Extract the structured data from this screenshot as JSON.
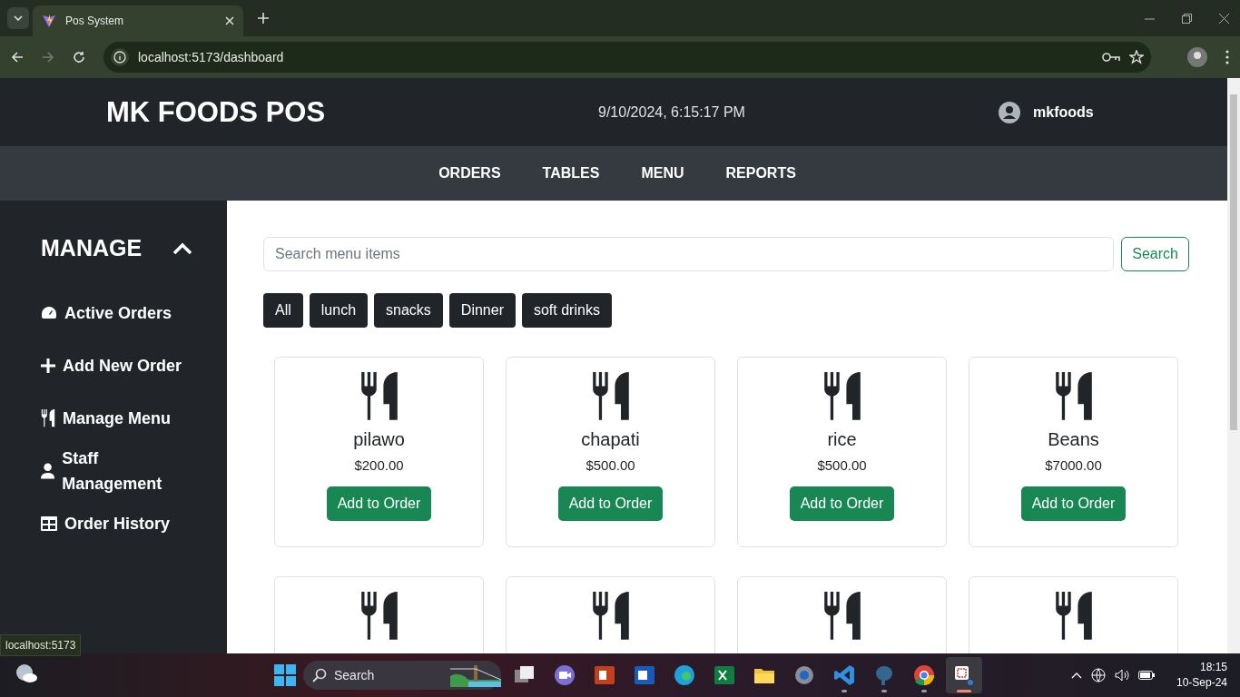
{
  "browser": {
    "tab_title": "Pos System",
    "url": "localhost:5173/dashboard",
    "status_url": "localhost:5173"
  },
  "header": {
    "brand": "MK FOODS POS",
    "datetime": "9/10/2024, 6:15:17 PM",
    "username": "mkfoods"
  },
  "nav": [
    {
      "label": "ORDERS"
    },
    {
      "label": "TABLES"
    },
    {
      "label": "MENU"
    },
    {
      "label": "REPORTS"
    }
  ],
  "sidebar": {
    "title": "MANAGE",
    "expanded": true,
    "items": [
      {
        "label": "Active Orders",
        "kind": "gauge"
      },
      {
        "label": "Add New Order",
        "kind": "plus"
      },
      {
        "label": "Manage Menu",
        "kind": "utensils"
      },
      {
        "label": "Staff Management",
        "kind": "user"
      },
      {
        "label": "Order History",
        "kind": "table"
      }
    ]
  },
  "search": {
    "placeholder": "Search menu items",
    "button": "Search"
  },
  "filters": [
    {
      "label": "All"
    },
    {
      "label": "lunch"
    },
    {
      "label": "snacks"
    },
    {
      "label": "Dinner"
    },
    {
      "label": "soft drinks"
    }
  ],
  "menu_items": [
    {
      "kind": "card",
      "name": "pilawo",
      "price": "$200.00",
      "button": "Add to Order"
    },
    {
      "kind": "card",
      "name": "chapati",
      "price": "$500.00",
      "button": "Add to Order"
    },
    {
      "kind": "card",
      "name": "rice",
      "price": "$500.00",
      "button": "Add to Order"
    },
    {
      "kind": "card",
      "name": "Beans",
      "price": "$7000.00",
      "button": "Add to Order"
    },
    {
      "kind": "clipped"
    },
    {
      "kind": "clipped"
    },
    {
      "kind": "clipped"
    },
    {
      "kind": "clipped"
    }
  ],
  "taskbar": {
    "search_label": "Search",
    "time": "18:15",
    "date": "10-Sep-24",
    "apps": [
      {
        "kind": "taskview",
        "running": false,
        "active": false
      },
      {
        "kind": "teams",
        "running": false,
        "active": false
      },
      {
        "kind": "powerpoint",
        "running": false,
        "active": false
      },
      {
        "kind": "word",
        "running": false,
        "active": false
      },
      {
        "kind": "edge",
        "running": false,
        "active": false
      },
      {
        "kind": "excel",
        "running": false,
        "active": false
      },
      {
        "kind": "explorer",
        "running": false,
        "active": false
      },
      {
        "kind": "settings",
        "running": false,
        "active": false
      },
      {
        "kind": "vscode",
        "running": true,
        "active": false
      },
      {
        "kind": "postgres",
        "running": true,
        "active": false
      },
      {
        "kind": "chrome",
        "running": true,
        "active": false
      },
      {
        "kind": "snipping",
        "running": true,
        "active": true
      }
    ]
  }
}
